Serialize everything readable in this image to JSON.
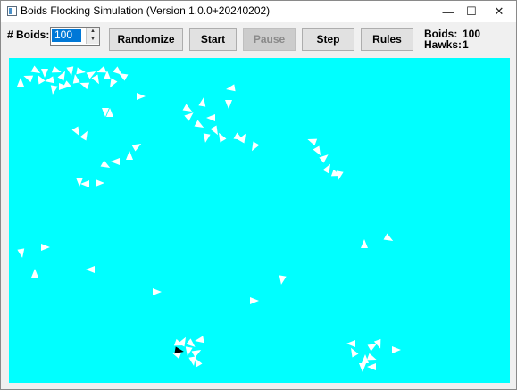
{
  "window": {
    "title": "Boids Flocking Simulation  (Version 1.0.0+20240202)",
    "controls": {
      "minimize": "—",
      "maximize": "☐",
      "close": "✕"
    }
  },
  "toolbar": {
    "boids_count_label": "# Boids:",
    "boids_count_value": "100",
    "randomize_label": "Randomize",
    "start_label": "Start",
    "pause_label": "Pause",
    "step_label": "Step",
    "rules_label": "Rules"
  },
  "stats": {
    "boids_label": "Boids:",
    "boids_value": "100",
    "hawks_label": "Hawks:",
    "hawks_value": "1"
  },
  "colors": {
    "canvas": "#00ffff",
    "boid": "#ffffff",
    "hawk": "#000000",
    "selection": "#0078d7"
  },
  "icons": {
    "spin_up": "▲",
    "spin_down": "▼"
  }
}
